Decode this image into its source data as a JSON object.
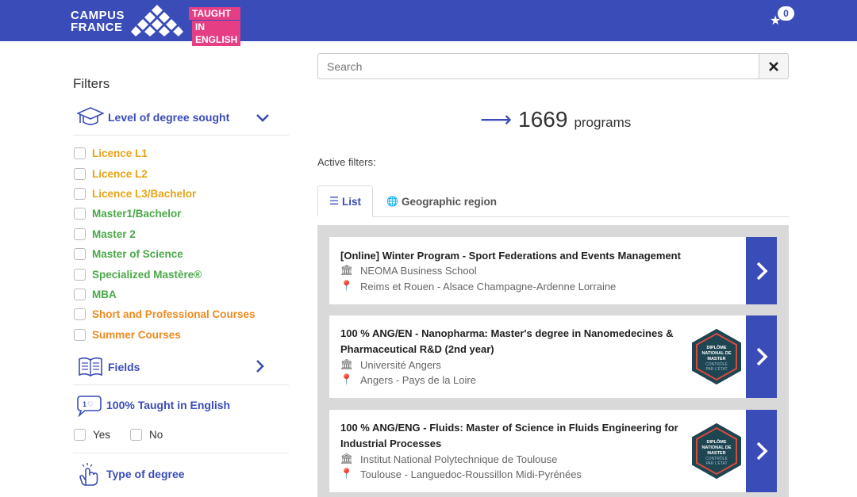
{
  "header": {
    "logo_line1": "CAMPUS",
    "logo_line2": "FRANCE",
    "taught_line1": "TAUGHT",
    "taught_line2": "IN ENGLISH",
    "cart_count": "0",
    "brand_color": "#3a4cb8",
    "accent_color": "#e63e84"
  },
  "sidebar": {
    "title": "Filters",
    "level": {
      "label": "Level of degree sought",
      "icon": "graduation-cap-icon",
      "items": [
        {
          "label": "Licence L1",
          "color": "#e8a317"
        },
        {
          "label": "Licence L2",
          "color": "#e8a317"
        },
        {
          "label": "Licence L3/Bachelor",
          "color": "#e8a317"
        },
        {
          "label": "Master1/Bachelor",
          "color": "#4aa84a"
        },
        {
          "label": "Master 2",
          "color": "#4aa84a"
        },
        {
          "label": "Master of Science",
          "color": "#4aa84a"
        },
        {
          "label": "Specialized Mastère®",
          "color": "#4aa84a"
        },
        {
          "label": "MBA",
          "color": "#4aa84a"
        },
        {
          "label": "Short and Professional Courses",
          "color": "#ef8a1e"
        },
        {
          "label": "Summer Courses",
          "color": "#ef8a1e"
        }
      ]
    },
    "fields": {
      "label": "Fields",
      "icon": "book-icon"
    },
    "taught_english": {
      "label": "100% Taught in English",
      "icon": "speech-bubble-icon",
      "yes": "Yes",
      "no": "No"
    },
    "type_degree": {
      "label": "Type of degree",
      "icon": "hand-pointer-icon"
    }
  },
  "main": {
    "search_placeholder": "Search",
    "count": "1669",
    "count_unit": "programs",
    "active_filters": "Active filters:",
    "tabs": {
      "list": "List",
      "geo": "Geographic region"
    },
    "programs": [
      {
        "title": "[Online] Winter Program - Sport Federations and Events Management",
        "school": "NEOMA Business School",
        "location": "Reims et Rouen - Alsace Champagne-Ardenne Lorraine",
        "badge": false
      },
      {
        "title": "100 % ANG/EN - Nanopharma: Master's degree in Nanomedecines & Pharmaceutical R&D (2nd year)",
        "school": "Université Angers",
        "location": "Angers - Pays de la Loire",
        "badge": true
      },
      {
        "title": "100 % ANG/ENG - Fluids: Master of Science in Fluids Engineering for Industrial Processes",
        "school": "Institut National Polytechnique de Toulouse",
        "location": "Toulouse - Languedoc-Roussillon Midi-Pyrénées",
        "badge": true
      }
    ],
    "badge_text": [
      "DIPLÔME",
      "NATIONAL DE",
      "MASTER",
      "CONTRÔLÉ",
      "PAR L'ÉTAT"
    ]
  }
}
